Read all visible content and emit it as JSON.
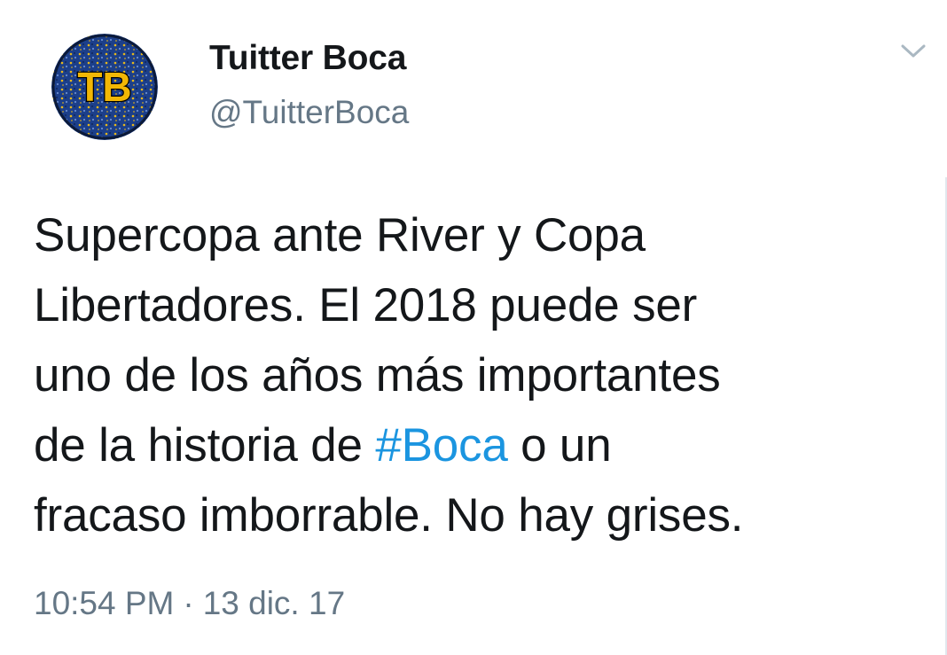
{
  "tweet": {
    "author": {
      "display_name": "Tuitter Boca",
      "handle": "@TuitterBoca",
      "avatar_initials": "TB",
      "avatar_colors": {
        "background": "#1c3f8a",
        "speckle": "#e8b81a",
        "letters": "#f2b705",
        "border": "#0b1a3a"
      }
    },
    "text_lines": {
      "line1": "Supercopa ante River y Copa",
      "line2": "Libertadores. El 2018 puede ser",
      "line3": "uno de los años más importantes",
      "line4_before": "de la historia de ",
      "hashtag": "#Boca",
      "line4_after": " o un",
      "line5": "fracaso imborrable. No hay grises."
    },
    "time": "10:54 PM",
    "separator": "·",
    "date": "13 dic. 17",
    "menu_icon": "chevron-down-icon"
  },
  "colors": {
    "text": "#14171a",
    "secondary": "#657786",
    "link": "#1b95e0"
  }
}
